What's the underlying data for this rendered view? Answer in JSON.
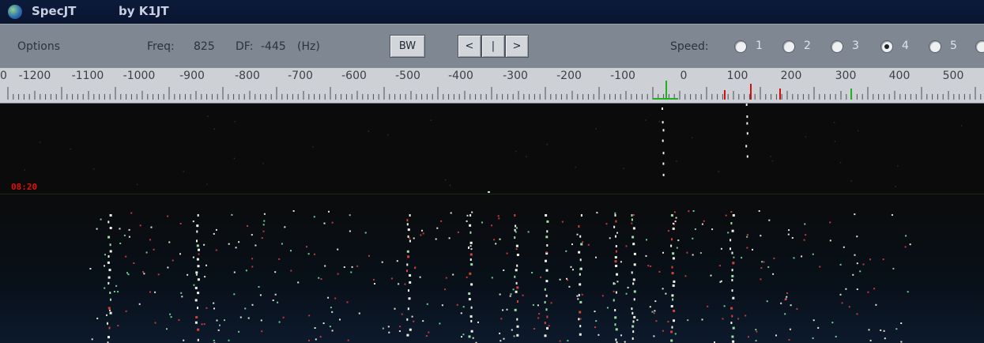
{
  "window": {
    "app_name": "SpecJT",
    "author": "by K1JT"
  },
  "toolbar": {
    "options_label": "Options",
    "freq_label": "Freq:",
    "freq_value": "825",
    "df_label": "DF:",
    "df_value": "-445",
    "df_unit": "(Hz)",
    "bw_label": "BW",
    "nav_left": "<",
    "nav_center": "|",
    "nav_right": ">",
    "speed_label": "Speed:",
    "speed_options": [
      "1",
      "2",
      "3",
      "4",
      "5"
    ],
    "speed_selected": "4"
  },
  "ruler": {
    "labels": [
      "0",
      "-1200",
      "-1100",
      "-1000",
      "-900",
      "-800",
      "-700",
      "-600",
      "-500",
      "-400",
      "-300",
      "-200",
      "-100",
      "0",
      "100",
      "200",
      "300",
      "400",
      "500"
    ]
  },
  "waterfall": {
    "timestamp": "08:20"
  },
  "colors": {
    "title_bg": "#0b1836",
    "toolbar_bg": "#7e8792",
    "ruler_bg": "#cdd1d5",
    "marker_green": "#22b022",
    "marker_red": "#d01010",
    "timestamp": "#e01010"
  }
}
